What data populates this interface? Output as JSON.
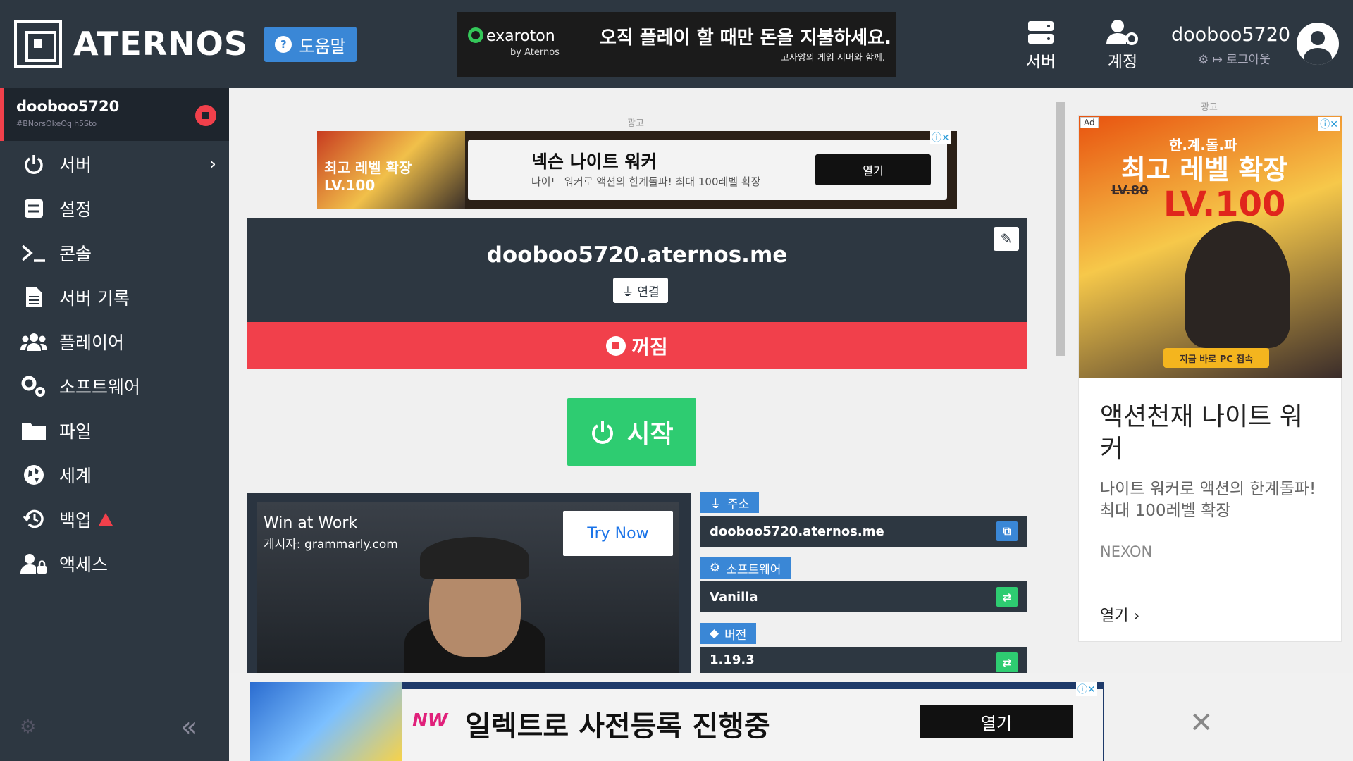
{
  "header": {
    "logo_text": "ATERNOS",
    "help_label": "도움말",
    "top_ad": {
      "brand": "exaroton",
      "brand_sub": "by Aternos",
      "title": "오직 플레이 할 때만 돈을 지불하세요.",
      "subtitle": "고사양의 게임 서버와 함께."
    },
    "nav_servers": "서버",
    "nav_account": "계정",
    "username": "dooboo5720",
    "logout": "로그아웃"
  },
  "sidebar": {
    "server_name": "dooboo5720",
    "server_id": "#BNorsOkeOqlh5Sto",
    "items": [
      {
        "label": "서버"
      },
      {
        "label": "설정"
      },
      {
        "label": "콘솔"
      },
      {
        "label": "서버 기록"
      },
      {
        "label": "플레이어"
      },
      {
        "label": "소프트웨어"
      },
      {
        "label": "파일"
      },
      {
        "label": "세계"
      },
      {
        "label": "백업"
      },
      {
        "label": "액세스"
      }
    ]
  },
  "main": {
    "ad_label": "광고",
    "banner_ad": {
      "left_text": "최고 레벨 확장 LV.100",
      "title": "넥슨 나이트 워커",
      "desc": "나이트 워커로 액션의 한계돌파! 최대 100레벨 확장",
      "open": "열기"
    },
    "status": {
      "domain": "dooboo5720.aternos.me",
      "connect_label": "연결",
      "state": "꺼짐"
    },
    "start_label": "시작",
    "video_ad": {
      "title": "Win at Work",
      "by": "게시자: grammarly.com",
      "cta": "Try Now"
    },
    "info": {
      "address_tag": "주소",
      "address_value": "dooboo5720.aternos.me",
      "software_tag": "소프트웨어",
      "software_value": "Vanilla",
      "version_tag": "버전",
      "version_value": "1.19.3"
    }
  },
  "right_ad": {
    "label": "광고",
    "ad_tag": "Ad",
    "img_top": "한.계.돌.파",
    "img_big": "최고 레벨 확장",
    "img_lvl_old": "LV.80",
    "img_lvl": "LV.100",
    "img_cta": "지금 바로 PC 접속",
    "headline": "액션천재 나이트 워커",
    "desc": "나이트 워커로 액션의 한계돌파! 최대 100레벨 확장",
    "brand": "NEXON",
    "open": "열기"
  },
  "bottom_ad": {
    "logo": "NW",
    "text": "일렉트로 사전등록 진행중",
    "open": "열기"
  },
  "colors": {
    "sidebar_bg": "#2d3741",
    "danger": "#f1404b",
    "success": "#2ecc71",
    "info": "#3a87d6"
  }
}
